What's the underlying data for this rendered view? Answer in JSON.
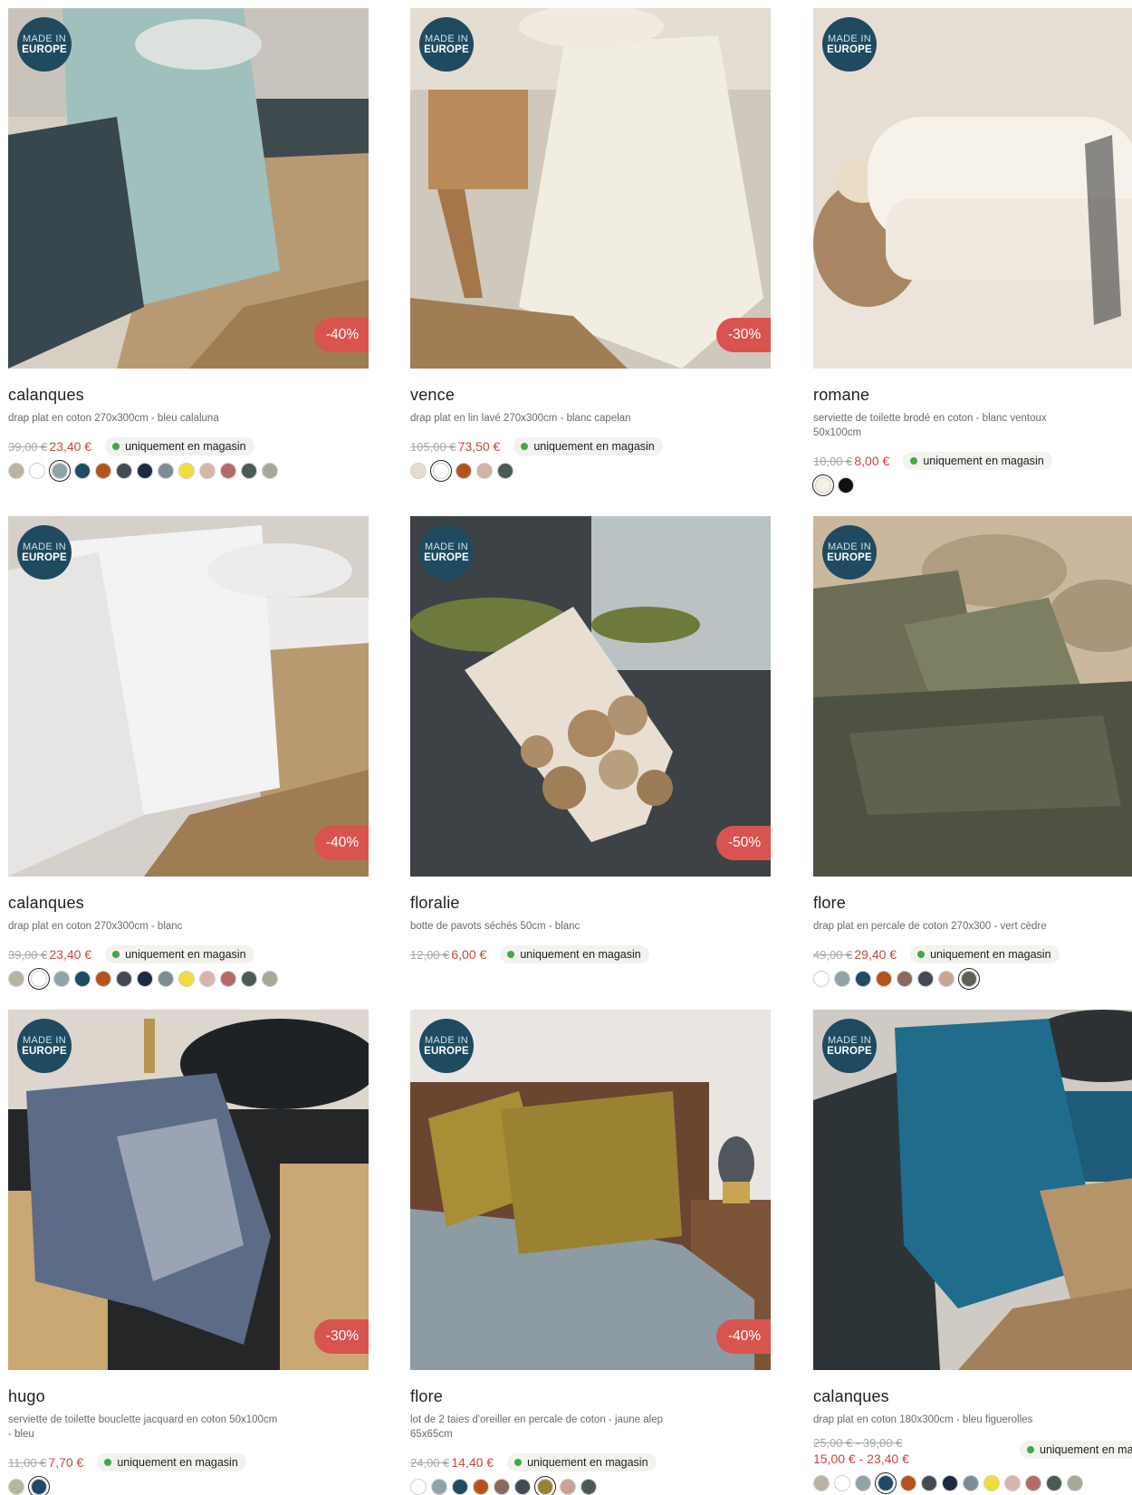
{
  "badge": {
    "line1": "MADE IN",
    "line2": "EUROPE"
  },
  "availability": "uniquement en magasin",
  "products": [
    {
      "name": "calanques",
      "description": "drap plat en coton 270x300cm - bleu calaluna",
      "old_price": "39,00 €",
      "new_price": "23,40 €",
      "discount": "-40%",
      "swatches": [
        "#b9b3a2",
        "#ffffff",
        "#8fa4a6",
        "#1c4c66",
        "#b6531c",
        "#444a52",
        "#1d2a44",
        "#7d8d96",
        "#f1dc3a",
        "#d8b5ab",
        "#b56a6a",
        "#4b5a52",
        "#a3aa98"
      ],
      "selected_swatch": 2
    },
    {
      "name": "vence",
      "description": "drap plat en lin lavé 270x300cm - blanc capelan",
      "old_price": "105,00 €",
      "new_price": "73,50 €",
      "discount": "-30%",
      "swatches": [
        "#e6ddcf",
        "#ffffff",
        "#b6531c",
        "#d2b2a3",
        "#4b5a52"
      ],
      "selected_swatch": 1
    },
    {
      "name": "romane",
      "description": "serviette de toilette brodé en coton - blanc ventoux 50x100cm",
      "old_price": "10,00 €",
      "new_price": "8,00 €",
      "discount": "",
      "swatches": [
        "#f4f1e6",
        "#111111"
      ],
      "selected_swatch": 0
    },
    {
      "name": "calanques",
      "description": "drap plat en coton 270x300cm - blanc",
      "old_price": "39,00 €",
      "new_price": "23,40 €",
      "discount": "-40%",
      "swatches": [
        "#b9b3a2",
        "#ffffff",
        "#8fa4a6",
        "#1c4c66",
        "#b6531c",
        "#444a52",
        "#1d2a44",
        "#7d8d96",
        "#f1dc3a",
        "#d8b5ab",
        "#b56a6a",
        "#4b5a52",
        "#a3aa98"
      ],
      "selected_swatch": 1
    },
    {
      "name": "floralie",
      "description": "botte de pavots séchés 50cm - blanc",
      "old_price": "12,00 €",
      "new_price": "6,00 €",
      "discount": "-50%",
      "swatches": [],
      "selected_swatch": -1
    },
    {
      "name": "flore",
      "description": "drap plat en percale de coton 270x300 - vert cèdre",
      "old_price": "49,00 €",
      "new_price": "29,40 €",
      "discount": "",
      "swatches": [
        "#ffffff",
        "#8fa4a6",
        "#1c4c66",
        "#b6531c",
        "#8a6a5e",
        "#444a52",
        "#c9a394",
        "#5b6254"
      ],
      "selected_swatch": 7
    },
    {
      "name": "hugo",
      "description": "serviette de toilette bouclette jacquard en coton 50x100cm - bleu",
      "old_price": "11,00 €",
      "new_price": "7,70 €",
      "discount": "-30%",
      "swatches": [
        "#b9b3a2",
        "#1c4c66"
      ],
      "selected_swatch": 1
    },
    {
      "name": "flore",
      "description": "lot de 2 taies d'oreiller en percale de coton - jaune alep 65x65cm",
      "old_price": "24,00 €",
      "new_price": "14,40 €",
      "discount": "-40%",
      "swatches": [
        "#ffffff",
        "#8fa4a6",
        "#1c4c66",
        "#b6531c",
        "#8a6a5e",
        "#444a52",
        "#9a8232",
        "#c9a394",
        "#4b5a52"
      ],
      "selected_swatch": 6
    },
    {
      "name": "calanques",
      "description": "drap plat en coton 180x300cm - bleu figuerolles",
      "old_price": "25,00 € - 39,00 €",
      "new_price": "15,00 € - 23,40 €",
      "discount": "",
      "swatches": [
        "#b9b3a2",
        "#ffffff",
        "#8fa4a6",
        "#1c4c66",
        "#b6531c",
        "#444a52",
        "#1d2a44",
        "#7d8d96",
        "#f1dc3a",
        "#d8b5ab",
        "#b56a6a",
        "#4b5a52",
        "#a3aa98"
      ],
      "selected_swatch": 3
    }
  ]
}
